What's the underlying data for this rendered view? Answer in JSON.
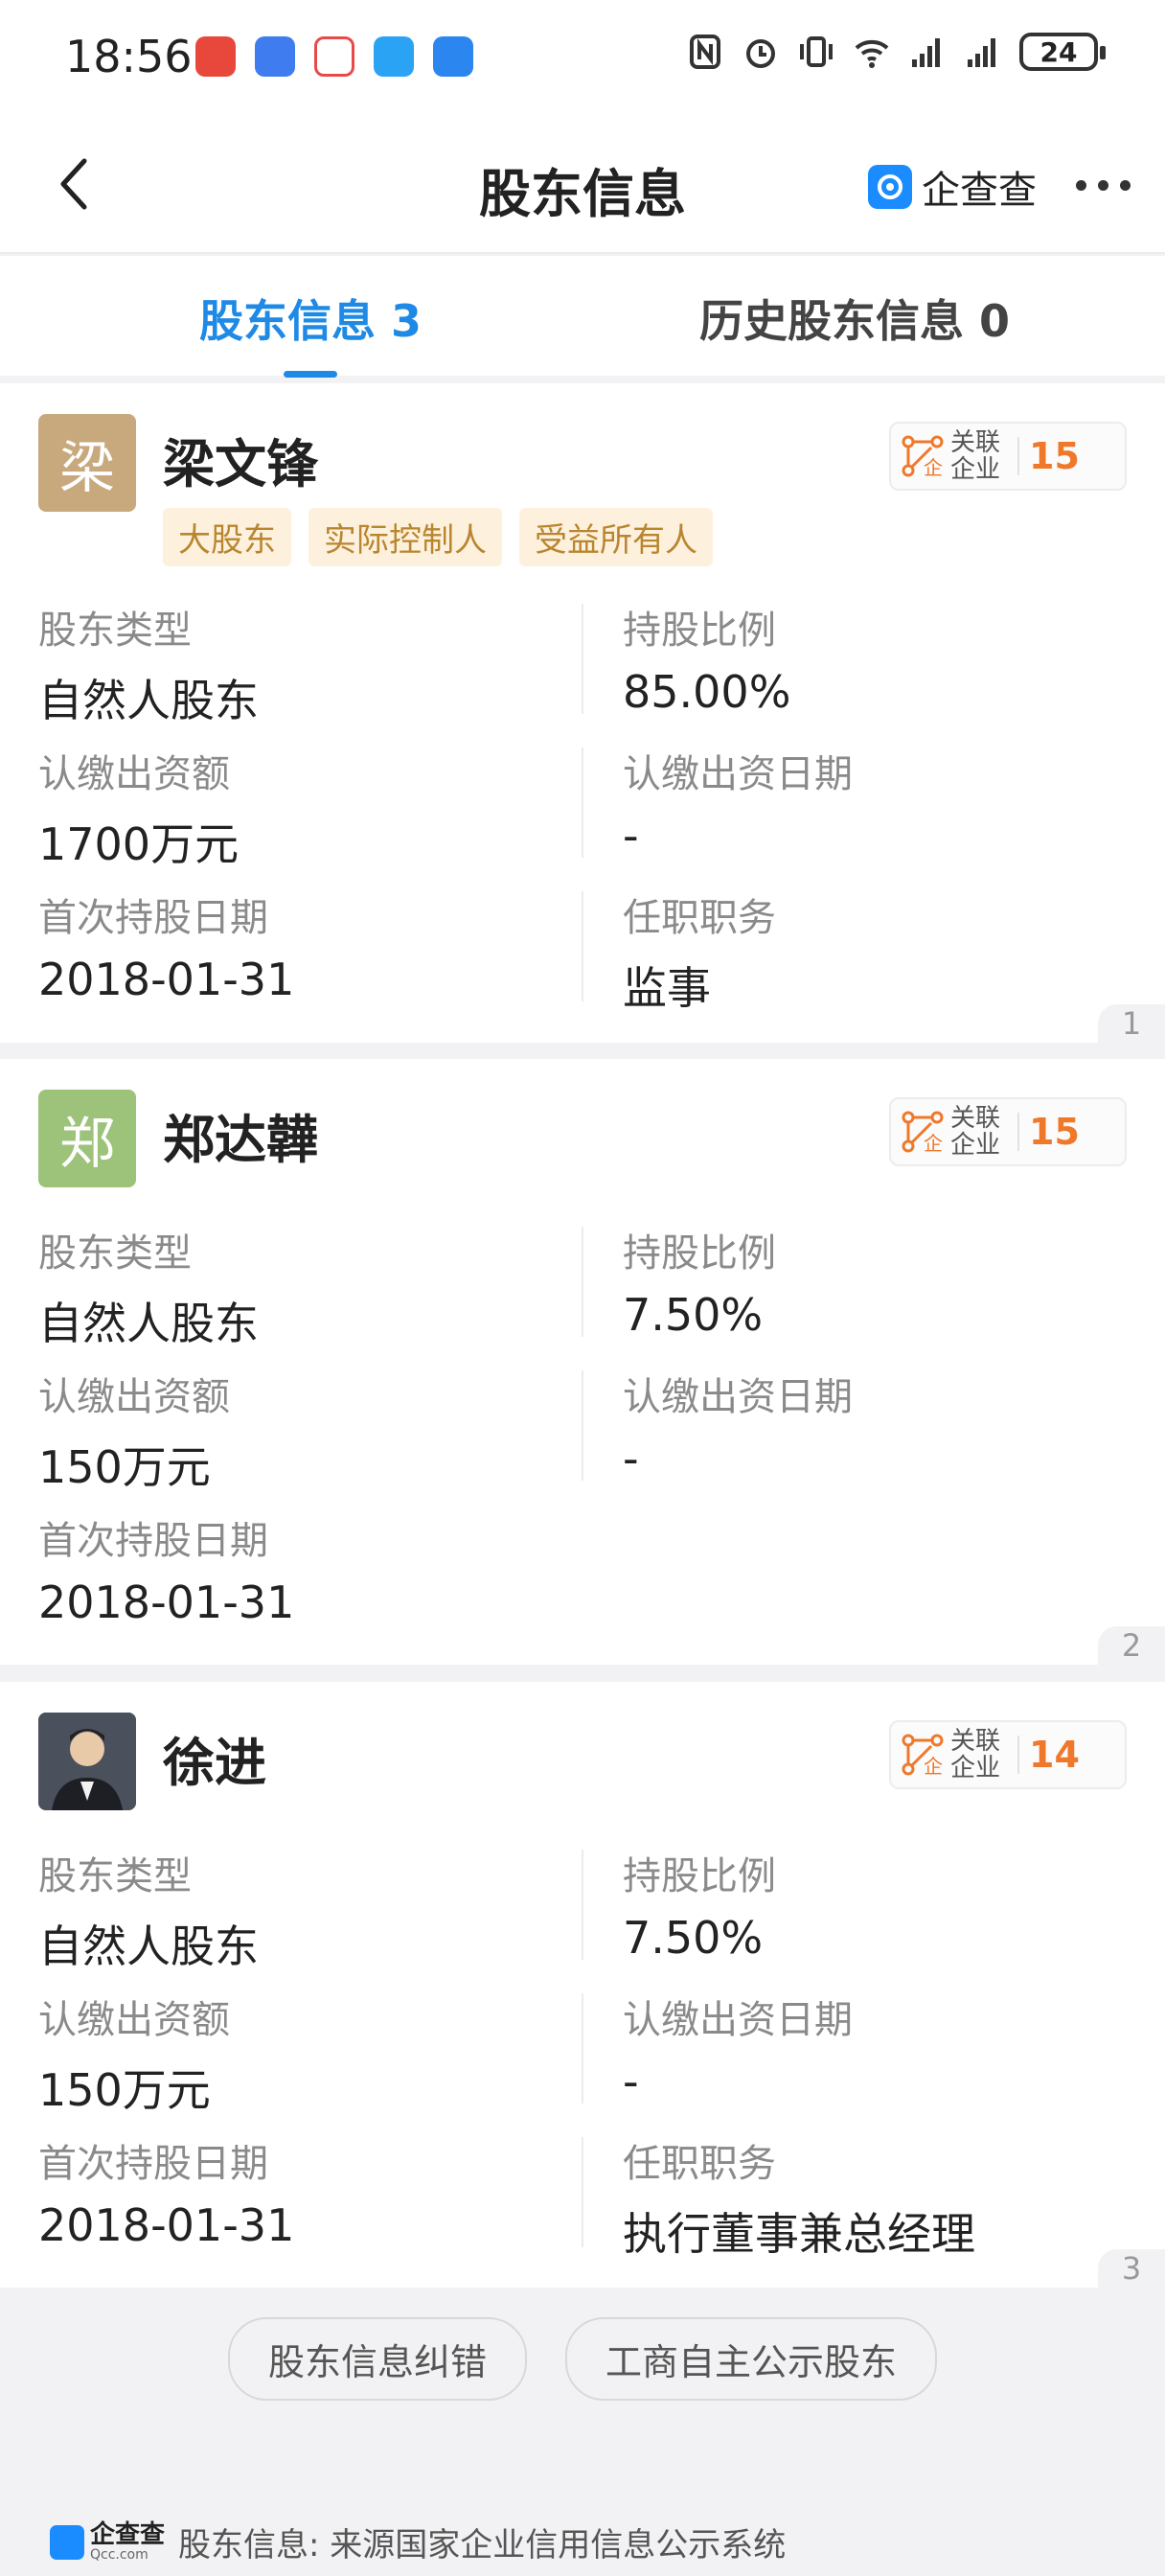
{
  "status_bar": {
    "time": "18:56",
    "battery": "24"
  },
  "nav": {
    "title": "股东信息",
    "brand": "企查查"
  },
  "tabs": [
    {
      "label": "股东信息 3"
    },
    {
      "label": "历史股东信息 0"
    }
  ],
  "rel_label": {
    "line1": "关联",
    "line2": "企业"
  },
  "shareholders": [
    {
      "avatar_char": "梁",
      "name": "梁文锋",
      "tags": [
        "大股东",
        "实际控制人",
        "受益所有人"
      ],
      "related_count": "15",
      "index": "1",
      "fields": {
        "type_label": "股东类型",
        "type": "自然人股东",
        "ratio_label": "持股比例",
        "ratio": "85.00%",
        "amount_label": "认缴出资额",
        "amount": "1700万元",
        "date_label": "认缴出资日期",
        "date": "-",
        "first_label": "首次持股日期",
        "first": "2018-01-31",
        "role_label": "任职职务",
        "role": "监事"
      }
    },
    {
      "avatar_char": "郑",
      "name": "郑达韡",
      "related_count": "15",
      "index": "2",
      "fields": {
        "type_label": "股东类型",
        "type": "自然人股东",
        "ratio_label": "持股比例",
        "ratio": "7.50%",
        "amount_label": "认缴出资额",
        "amount": "150万元",
        "date_label": "认缴出资日期",
        "date": "-",
        "first_label": "首次持股日期",
        "first": "2018-01-31"
      }
    },
    {
      "name": "徐进",
      "related_count": "14",
      "index": "3",
      "fields": {
        "type_label": "股东类型",
        "type": "自然人股东",
        "ratio_label": "持股比例",
        "ratio": "7.50%",
        "amount_label": "认缴出资额",
        "amount": "150万元",
        "date_label": "认缴出资日期",
        "date": "-",
        "first_label": "首次持股日期",
        "first": "2018-01-31",
        "role_label": "任职职务",
        "role": "执行董事兼总经理"
      }
    }
  ],
  "actions": {
    "correction": "股东信息纠错",
    "self_disclosure": "工商自主公示股东"
  },
  "footer": {
    "logo": "企查查",
    "logo_sub": "Qcc.com",
    "source": "股东信息: 来源国家企业信用信息公示系统"
  },
  "colors": {
    "accent": "#1f8ae6",
    "tag_bg": "#fdf1de",
    "tag_text": "#b9862f",
    "count": "#f0782a"
  }
}
